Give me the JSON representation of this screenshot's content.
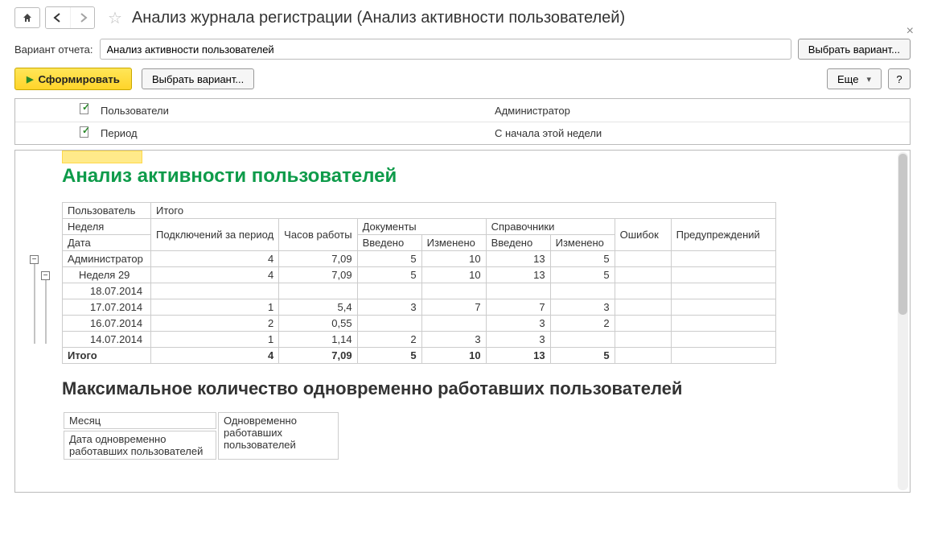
{
  "header": {
    "title": "Анализ журнала регистрации (Анализ активности пользователей)"
  },
  "variant": {
    "label": "Вариант отчета:",
    "value": "Анализ активности пользователей",
    "choose_label": "Выбрать вариант..."
  },
  "toolbar": {
    "run_label": "Сформировать",
    "choose_label": "Выбрать вариант...",
    "more_label": "Еще",
    "help_label": "?"
  },
  "params": {
    "rows": [
      {
        "name": "Пользователи",
        "value": "Администратор"
      },
      {
        "name": "Период",
        "value": "С начала этой недели"
      }
    ]
  },
  "report": {
    "title": "Анализ активности пользователей",
    "headers": {
      "user": "Пользователь",
      "total": "Итого",
      "week": "Неделя",
      "date": "Дата",
      "connections": "Подключений за период",
      "hours": "Часов работы",
      "docs": "Документы",
      "refs": "Справочники",
      "added": "Введено",
      "changed": "Изменено",
      "errors": "Ошибок",
      "warnings": "Предупреждений"
    },
    "rows": [
      {
        "label": "Администратор",
        "conn": "4",
        "hours": "7,09",
        "doc_add": "5",
        "doc_chg": "10",
        "ref_add": "13",
        "ref_chg": "5",
        "indent": 0
      },
      {
        "label": "Неделя 29",
        "conn": "4",
        "hours": "7,09",
        "doc_add": "5",
        "doc_chg": "10",
        "ref_add": "13",
        "ref_chg": "5",
        "indent": 1
      },
      {
        "label": "18.07.2014",
        "conn": "",
        "hours": "",
        "doc_add": "",
        "doc_chg": "",
        "ref_add": "",
        "ref_chg": "",
        "indent": 2
      },
      {
        "label": "17.07.2014",
        "conn": "1",
        "hours": "5,4",
        "doc_add": "3",
        "doc_chg": "7",
        "ref_add": "7",
        "ref_chg": "3",
        "indent": 2
      },
      {
        "label": "16.07.2014",
        "conn": "2",
        "hours": "0,55",
        "doc_add": "",
        "doc_chg": "",
        "ref_add": "3",
        "ref_chg": "2",
        "indent": 2
      },
      {
        "label": "14.07.2014",
        "conn": "1",
        "hours": "1,14",
        "doc_add": "2",
        "doc_chg": "3",
        "ref_add": "3",
        "ref_chg": "",
        "indent": 2
      }
    ],
    "total_row": {
      "label": "Итого",
      "conn": "4",
      "hours": "7,09",
      "doc_add": "5",
      "doc_chg": "10",
      "ref_add": "13",
      "ref_chg": "5"
    },
    "sub_title": "Максимальное количество одновременно работавших пользователей",
    "sub_headers": {
      "month": "Месяц",
      "date_col": "Дата одновременно работавших пользователей",
      "count_col": "Одновременно работавших пользователей"
    }
  }
}
